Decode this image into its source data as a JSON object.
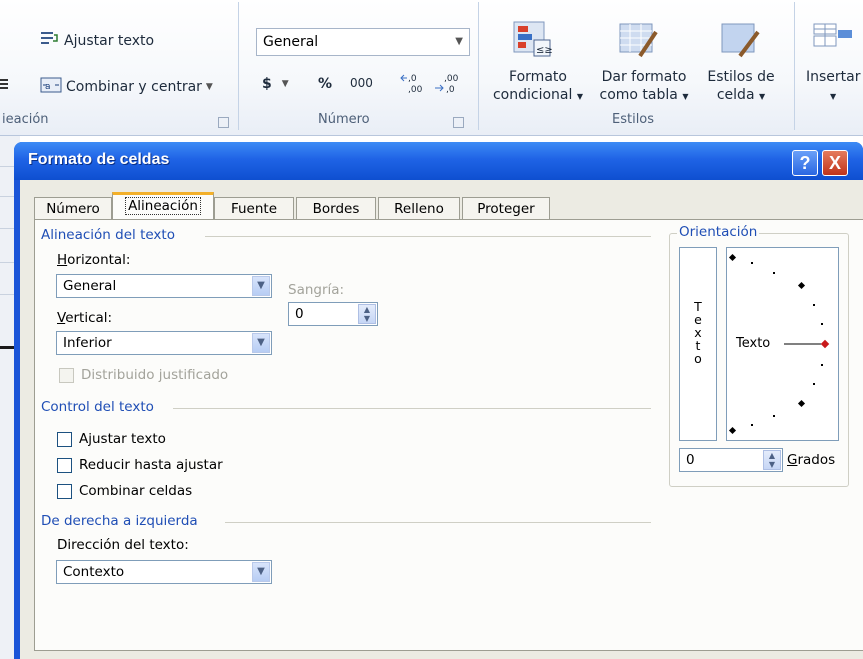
{
  "ribbon": {
    "wrap_text": "Ajustar texto",
    "merge_center": "Combinar y centrar",
    "alignment_group": "ieación",
    "number_format": "General",
    "currency": "$",
    "percent": "%",
    "thousands": "000",
    "number_group": "Número",
    "conditional_format_line1": "Formato",
    "conditional_format_line2": "condicional",
    "format_table_line1": "Dar formato",
    "format_table_line2": "como tabla",
    "cell_styles_line1": "Estilos de",
    "cell_styles_line2": "celda",
    "styles_group": "Estilos",
    "insert": "Insertar"
  },
  "dialog": {
    "title": "Formato de celdas",
    "help_label": "?",
    "close_label": "X",
    "tabs": [
      "Número",
      "Alineación",
      "Fuente",
      "Bordes",
      "Relleno",
      "Proteger"
    ],
    "active_tab": "Alineación",
    "text_alignment": {
      "section": "Alineación del texto",
      "horizontal_label": "Horizontal:",
      "horizontal_value": "General",
      "indent_label": "Sangría:",
      "indent_value": "0",
      "vertical_label": "Vertical:",
      "vertical_value": "Inferior",
      "justify_distributed": "Distribuido justificado"
    },
    "text_control": {
      "section": "Control del texto",
      "wrap_text": "Ajustar texto",
      "shrink_to_fit": "Reducir hasta ajustar",
      "merge_cells": "Combinar celdas"
    },
    "rtl": {
      "section": "De derecha a izquierda",
      "direction_label": "Dirección del texto:",
      "direction_value": "Contexto"
    },
    "orientation": {
      "section": "Orientación",
      "vertical_text": [
        "T",
        "e",
        "x",
        "t",
        "o"
      ],
      "dial_text": "Texto",
      "degrees_value": "0",
      "degrees_label": "Grados"
    }
  }
}
